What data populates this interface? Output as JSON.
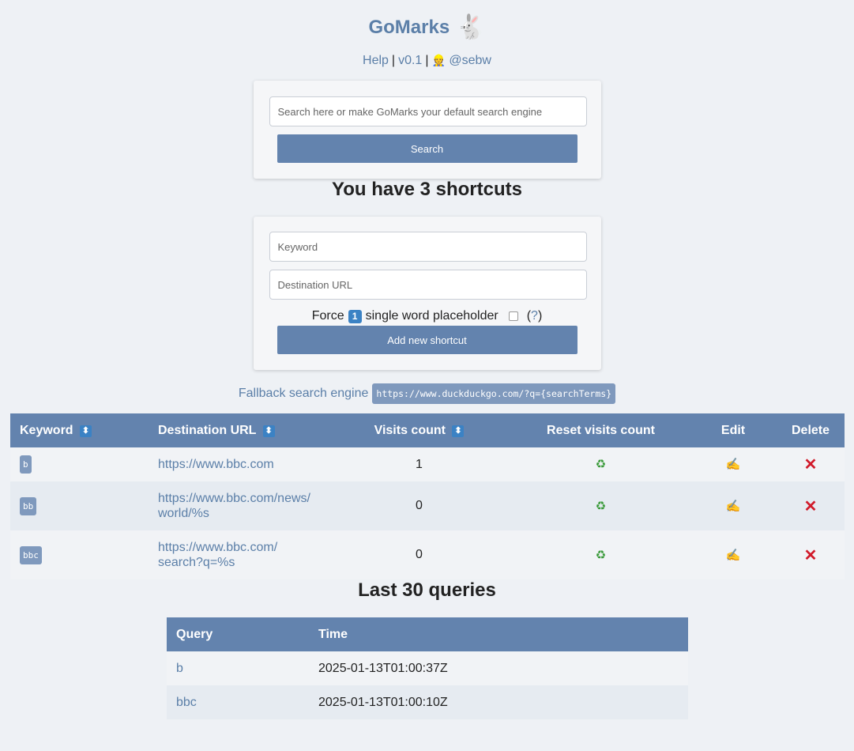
{
  "header": {
    "title": "GoMarks",
    "help": "Help",
    "sep1": "|",
    "version": "v0.1",
    "sep2": "|",
    "author_icon": "👷",
    "author": "@sebw",
    "logo_icon": "🐇"
  },
  "search": {
    "placeholder": "Search here or make GoMarks your default search engine",
    "button": "Search"
  },
  "shortcuts_title": "You have 3 shortcuts",
  "add_form": {
    "keyword_placeholder": "Keyword",
    "url_placeholder": "Destination URL",
    "force_prefix": "Force",
    "force_badge": "1",
    "force_suffix": "single word placeholder",
    "help_open": "(",
    "help_link": "?",
    "help_close": ")",
    "button": "Add new shortcut"
  },
  "fallback": {
    "label": "Fallback search engine",
    "url": "https://www.duckduckgo.com/?q={searchTerms}"
  },
  "shortcuts_table": {
    "headers": {
      "keyword": "Keyword",
      "destination": "Destination URL",
      "visits": "Visits count",
      "reset": "Reset visits count",
      "edit": "Edit",
      "delete": "Delete"
    },
    "sort_icon": "⬍",
    "reset_icon": "♻",
    "edit_icon": "✍",
    "delete_icon": "✕",
    "rows": [
      {
        "keyword": "b",
        "url_line1": "https://www.bbc.com",
        "url_line2": "",
        "visits": "1"
      },
      {
        "keyword": "bb",
        "url_line1": "https://www.bbc.com/news/",
        "url_line2": "world/%s",
        "visits": "0"
      },
      {
        "keyword": "bbc",
        "url_line1": "https://www.bbc.com/",
        "url_line2": "search?q=%s",
        "visits": "0"
      }
    ]
  },
  "queries_title": "Last 30 queries",
  "queries_table": {
    "headers": {
      "query": "Query",
      "time": "Time"
    },
    "rows": [
      {
        "query": "b",
        "time": "2025-01-13T01:00:37Z"
      },
      {
        "query": "bbc",
        "time": "2025-01-13T01:00:10Z"
      }
    ]
  },
  "colors": {
    "accent": "#6383ae",
    "link": "#5b7fa8",
    "delete": "#d11a2a",
    "reset": "#3a9a3a"
  }
}
